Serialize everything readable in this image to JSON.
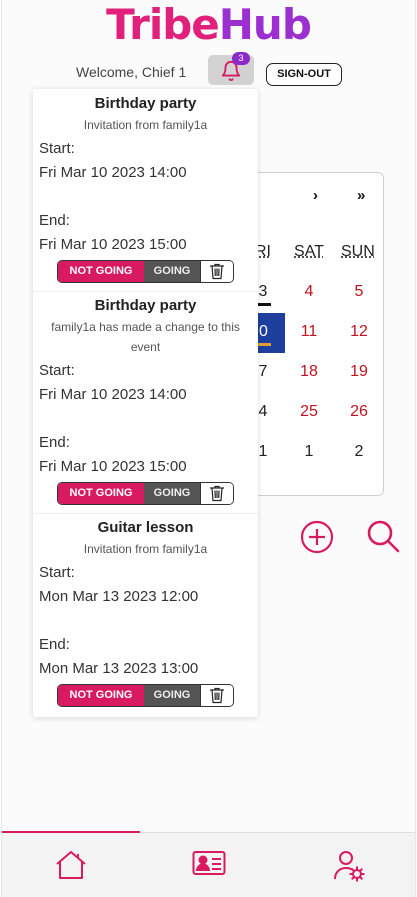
{
  "app": {
    "logo_part1": "Tribe",
    "logo_part2": "Hub",
    "welcome": "Welcome, Chief 1",
    "notification_count": "3",
    "signout_label": "SIGN-OUT"
  },
  "calendar": {
    "nav_next": "›",
    "nav_last": "»",
    "headers": [
      "RI",
      "SAT",
      "SUN"
    ],
    "rows": [
      [
        "3",
        "4",
        "5"
      ],
      [
        "0",
        "11",
        "12"
      ],
      [
        "7",
        "18",
        "19"
      ],
      [
        "4",
        "25",
        "26"
      ],
      [
        "1",
        "1",
        "2"
      ]
    ]
  },
  "notifications": [
    {
      "title": "Birthday party",
      "subtitle": "Invitation from family1a",
      "start_label": "Start:",
      "start": "Fri Mar 10 2023 14:00",
      "end_label": "End:",
      "end": "Fri Mar 10 2023 15:00",
      "not_going": "NOT GOING",
      "going": "GOING"
    },
    {
      "title": "Birthday party",
      "subtitle": "family1a has made a change to this event",
      "start_label": "Start:",
      "start": "Fri Mar 10 2023 14:00",
      "end_label": "End:",
      "end": "Fri Mar 10 2023 15:00",
      "not_going": "NOT GOING",
      "going": "GOING"
    },
    {
      "title": "Guitar lesson",
      "subtitle": "Invitation from family1a",
      "start_label": "Start:",
      "start": "Mon Mar 13 2023 12:00",
      "end_label": "End:",
      "end": "Mon Mar 13 2023 13:00",
      "not_going": "NOT GOING",
      "going": "GOING"
    }
  ],
  "colors": {
    "brand_pink": "#e0207a",
    "brand_purple": "#9b2fd0",
    "today_blue": "#1e3f9e",
    "weekend_red": "#c1121f"
  },
  "icons": {
    "bell": "bell-icon",
    "add": "plus-circle-icon",
    "search": "search-icon",
    "home": "home-icon",
    "contacts": "id-card-icon",
    "settings": "user-settings-icon",
    "trash": "trash-icon"
  }
}
